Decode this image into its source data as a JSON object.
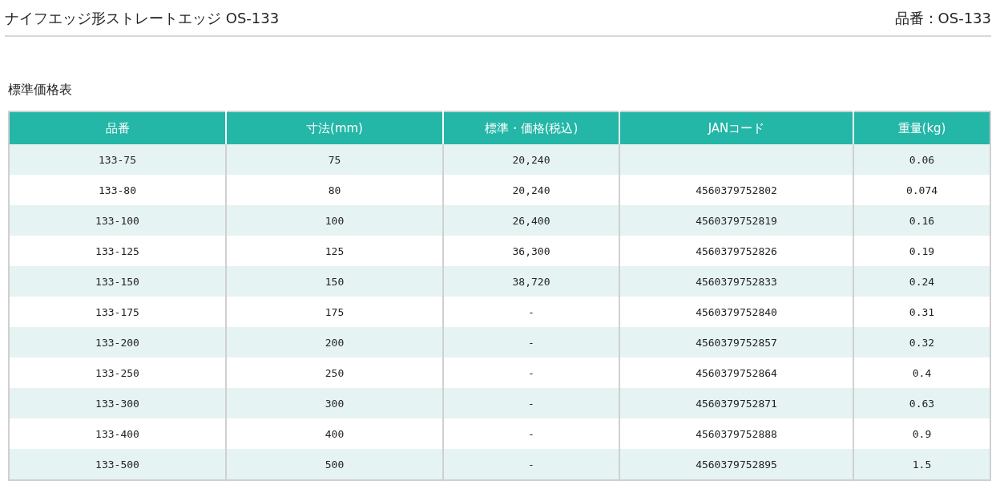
{
  "header": {
    "title": "ナイフエッジ形ストレートエッジ OS-133",
    "part_number": "品番：OS-133"
  },
  "section_title": "標準価格表",
  "table": {
    "columns": [
      "品番",
      "寸法(mm)",
      "標準・価格(税込)",
      "JANコード",
      "重量(kg)"
    ],
    "rows": [
      [
        "133-75",
        "75",
        "20,240",
        "",
        "0.06"
      ],
      [
        "133-80",
        "80",
        "20,240",
        "4560379752802",
        "0.074"
      ],
      [
        "133-100",
        "100",
        "26,400",
        "4560379752819",
        "0.16"
      ],
      [
        "133-125",
        "125",
        "36,300",
        "4560379752826",
        "0.19"
      ],
      [
        "133-150",
        "150",
        "38,720",
        "4560379752833",
        "0.24"
      ],
      [
        "133-175",
        "175",
        "-",
        "4560379752840",
        "0.31"
      ],
      [
        "133-200",
        "200",
        "-",
        "4560379752857",
        "0.32"
      ],
      [
        "133-250",
        "250",
        "-",
        "4560379752864",
        "0.4"
      ],
      [
        "133-300",
        "300",
        "-",
        "4560379752871",
        "0.63"
      ],
      [
        "133-400",
        "400",
        "-",
        "4560379752888",
        "0.9"
      ],
      [
        "133-500",
        "500",
        "-",
        "4560379752895",
        "1.5"
      ]
    ]
  }
}
